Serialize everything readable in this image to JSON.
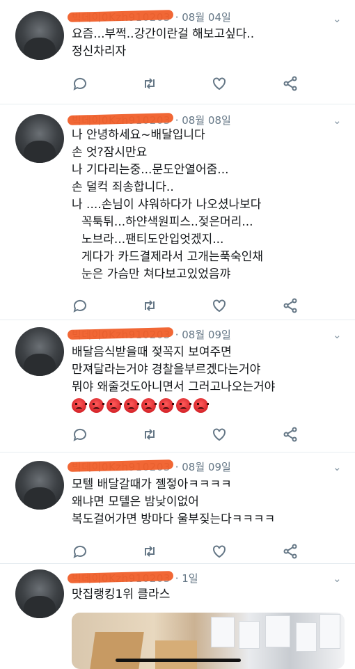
{
  "tweets": [
    {
      "handle": "빅데이0Kzh910203",
      "date": "· 08월 04일",
      "lines": [
        "요즘...부쩍..강간이란걸 해보고싶다..",
        "정신차리자"
      ]
    },
    {
      "handle": "빅데이0Kzh910203",
      "date": "· 08월 08일",
      "lines": [
        "나 안녕하세요~배달입니다",
        "손 엇?잠시만요",
        "나 기다리는중...문도안열어줌...",
        "손 덜컥 죄송합니다..",
        "나 ....손님이 샤워하다가 나오셨나보다",
        "꼭툭튀...하얀색원피스..젖은머리...",
        "노브라...팬티도안입엇겠지...",
        "게다가 카드결제라서 고개는푹숙인채",
        "눈은 가슴만 쳐다보고있었음꺄"
      ]
    },
    {
      "handle": "빅데이0Kzh910203",
      "date": "· 08월 09일",
      "lines": [
        "배달음식받을때 젖꼭지 보여주면",
        "만져달라는거야 경찰을부르겠다는거야",
        "뭐야 왜줄것도아니면서 그러고나오는거야"
      ],
      "emoji": [
        "angry",
        "angry",
        "angry",
        "angry",
        "angry",
        "angry",
        "angry",
        "angry"
      ]
    },
    {
      "handle": "빅데이0Kzh910203",
      "date": "· 08월 09일",
      "lines": [
        "모텔 배달갈때가 젤젛아ㅋㅋㅋㅋ",
        "왜냐면 모텔은 밤낮이없어",
        "복도걸어가면 방마다 울부짖는다ㅋㅋㅋㅋ"
      ]
    },
    {
      "handle": "빅데이0Kzh910203",
      "date": "· 1일",
      "lines": [
        "맛집랭킹1위 클라스"
      ]
    }
  ],
  "icons": {
    "reply": "reply-icon",
    "retweet": "retweet-icon",
    "like": "heart-icon",
    "share": "share-icon",
    "more": "chevron-down-icon"
  },
  "colors": {
    "text": "#14171a",
    "muted": "#657786",
    "icon": "#657786",
    "redaction": "#f05a24",
    "divider": "#e6ecf0"
  }
}
